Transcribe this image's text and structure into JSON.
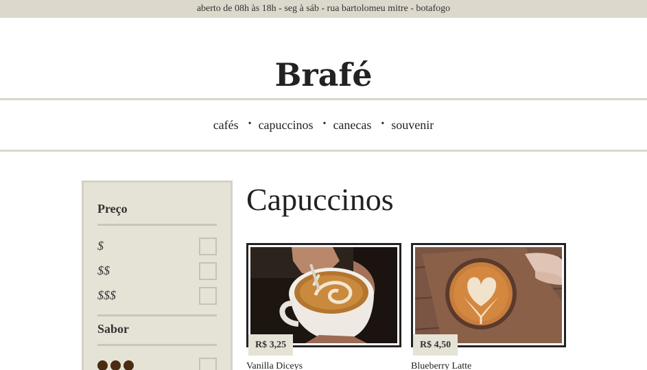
{
  "topbar": {
    "text": "aberto de 08h às 18h - seg à sáb - rua bartolomeu mitre - botafogo"
  },
  "header": {
    "brand": "Brafé"
  },
  "nav": {
    "items": [
      {
        "label": "cafés"
      },
      {
        "label": "capuccinos"
      },
      {
        "label": "canecas"
      },
      {
        "label": "souvenir"
      }
    ],
    "separator": "•"
  },
  "sidebar": {
    "price_title": "Preço",
    "price_options": [
      {
        "label": "$"
      },
      {
        "label": "$$"
      },
      {
        "label": "$$$"
      }
    ],
    "flavor_title": "Sabor",
    "flavor_levels": [
      3
    ]
  },
  "main": {
    "title": "Capuccinos",
    "products": [
      {
        "name": "Vanilla Diceys",
        "price": "R$ 3,25"
      },
      {
        "name": "Blueberry Latte",
        "price": "R$ 4,50"
      }
    ]
  },
  "colors": {
    "topbar_bg": "#dcd8cc",
    "sidebar_bg": "#e5e2d6",
    "bean": "#4a2c12"
  }
}
